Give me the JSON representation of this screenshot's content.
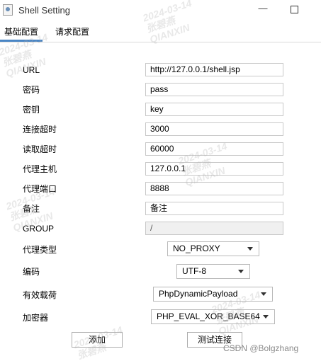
{
  "window": {
    "title": "Shell Setting"
  },
  "tabs": [
    {
      "label": "基础配置"
    },
    {
      "label": "请求配置"
    }
  ],
  "form": {
    "url": {
      "label": "URL",
      "value": "http://127.0.0.1/shell.jsp"
    },
    "password": {
      "label": "密码",
      "value": "pass"
    },
    "key": {
      "label": "密钥",
      "value": "key"
    },
    "connect_timeout": {
      "label": "连接超时",
      "value": "3000"
    },
    "read_timeout": {
      "label": "读取超时",
      "value": "60000"
    },
    "proxy_host": {
      "label": "代理主机",
      "value": "127.0.0.1"
    },
    "proxy_port": {
      "label": "代理端口",
      "value": "8888"
    },
    "remark": {
      "label": "备注",
      "value": "备注"
    },
    "group": {
      "label": "GROUP",
      "value": "/"
    },
    "proxy_type": {
      "label": "代理类型",
      "value": "NO_PROXY"
    },
    "encoding": {
      "label": "编码",
      "value": "UTF-8"
    },
    "payload": {
      "label": "有效载荷",
      "value": "PhpDynamicPayload"
    },
    "cryption": {
      "label": "加密器",
      "value": "PHP_EVAL_XOR_BASE64"
    }
  },
  "buttons": {
    "add": "添加",
    "test": "测试连接"
  },
  "watermark": {
    "date": "2024-03-14",
    "name": "张碧燕",
    "company": "QIANXIN"
  },
  "credit": "CSDN @Bolgzhang"
}
